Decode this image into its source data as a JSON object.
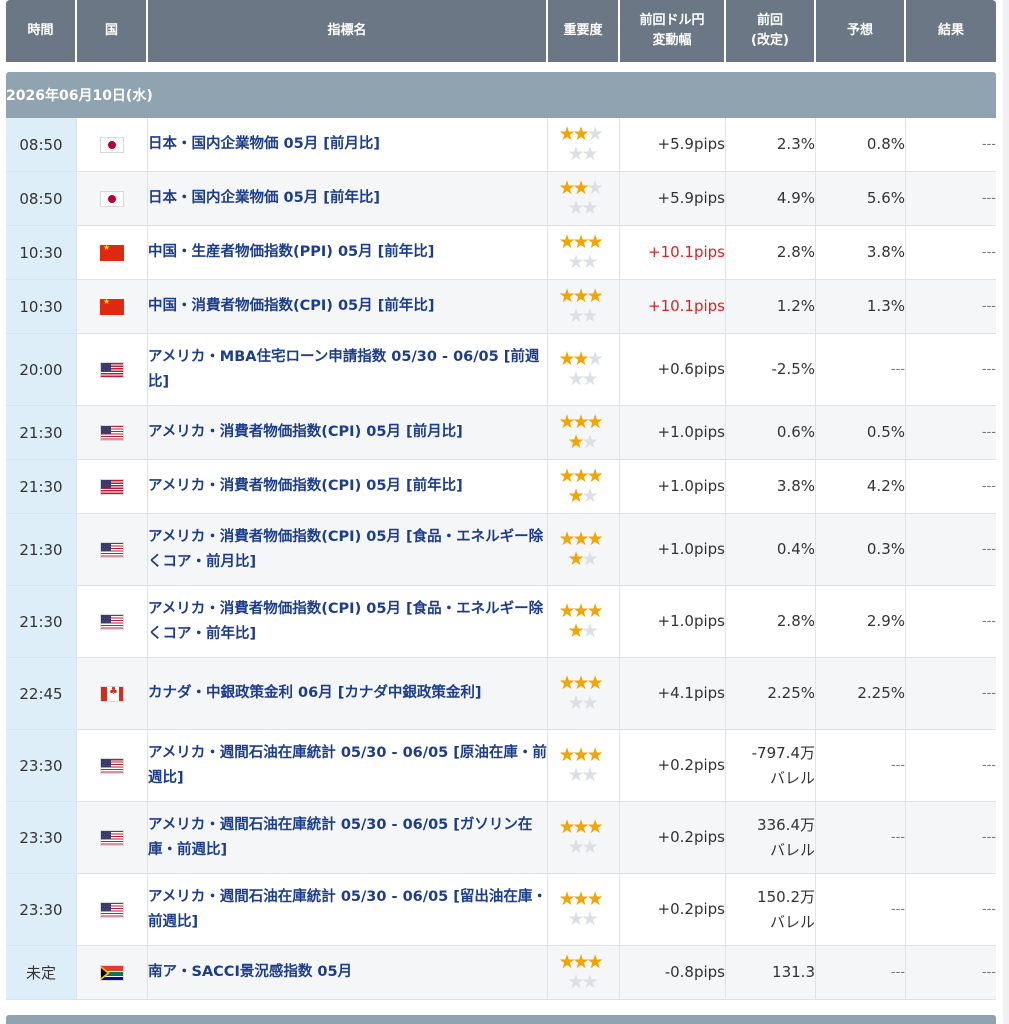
{
  "headers": {
    "time": "時間",
    "country": "国",
    "indicator": "指標名",
    "importance": "重要度",
    "change": "前回ドル円\n変動幅",
    "previous": "前回\n(改定)",
    "forecast": "予想",
    "result": "結果"
  },
  "date": "2026年06月10日(水)",
  "colors": {
    "header_bg": "#6b7784",
    "date_bg": "#8fa3b0",
    "time_bg": "#deeef9",
    "link": "#1c3d8c",
    "star_on": "#f2a400",
    "red": "#e02020"
  },
  "rows": [
    {
      "time": "08:50",
      "flag": "jp",
      "flag_icon": "japan-flag-icon",
      "name": "日本・国内企業物価 05月 [前月比]",
      "stars": 2,
      "change": "+5.9pips",
      "change_red": false,
      "previous": "2.3%",
      "forecast": "0.8%",
      "result": "---"
    },
    {
      "time": "08:50",
      "flag": "jp",
      "flag_icon": "japan-flag-icon",
      "name": "日本・国内企業物価 05月 [前年比]",
      "stars": 2,
      "change": "+5.9pips",
      "change_red": false,
      "previous": "4.9%",
      "forecast": "5.6%",
      "result": "---"
    },
    {
      "time": "10:30",
      "flag": "cn",
      "flag_icon": "china-flag-icon",
      "name": "中国・生産者物価指数(PPI) 05月 [前年比]",
      "stars": 3,
      "change": "+10.1pips",
      "change_red": true,
      "previous": "2.8%",
      "forecast": "3.8%",
      "result": "---"
    },
    {
      "time": "10:30",
      "flag": "cn",
      "flag_icon": "china-flag-icon",
      "name": "中国・消費者物価指数(CPI) 05月 [前年比]",
      "stars": 3,
      "change": "+10.1pips",
      "change_red": true,
      "previous": "1.2%",
      "forecast": "1.3%",
      "result": "---"
    },
    {
      "time": "20:00",
      "flag": "us",
      "flag_icon": "usa-flag-icon",
      "name": "アメリカ・MBA住宅ローン申請指数 05/30 - 06/05 [前週比]",
      "stars": 2,
      "change": "+0.6pips",
      "change_red": false,
      "previous": "-2.5%",
      "forecast": "---",
      "result": "---"
    },
    {
      "time": "21:30",
      "flag": "us",
      "flag_icon": "usa-flag-icon",
      "name": "アメリカ・消費者物価指数(CPI) 05月 [前月比]",
      "stars": 4,
      "change": "+1.0pips",
      "change_red": false,
      "previous": "0.6%",
      "forecast": "0.5%",
      "result": "---"
    },
    {
      "time": "21:30",
      "flag": "us",
      "flag_icon": "usa-flag-icon",
      "name": "アメリカ・消費者物価指数(CPI) 05月 [前年比]",
      "stars": 4,
      "change": "+1.0pips",
      "change_red": false,
      "previous": "3.8%",
      "forecast": "4.2%",
      "result": "---"
    },
    {
      "time": "21:30",
      "flag": "us",
      "flag_icon": "usa-flag-icon",
      "name": "アメリカ・消費者物価指数(CPI) 05月 [食品・エネルギー除くコア・前月比]",
      "stars": 4,
      "change": "+1.0pips",
      "change_red": false,
      "previous": "0.4%",
      "forecast": "0.3%",
      "result": "---"
    },
    {
      "time": "21:30",
      "flag": "us",
      "flag_icon": "usa-flag-icon",
      "name": "アメリカ・消費者物価指数(CPI) 05月 [食品・エネルギー除くコア・前年比]",
      "stars": 4,
      "change": "+1.0pips",
      "change_red": false,
      "previous": "2.8%",
      "forecast": "2.9%",
      "result": "---"
    },
    {
      "time": "22:45",
      "flag": "ca",
      "flag_icon": "canada-flag-icon",
      "name": "カナダ・中銀政策金利 06月 [カナダ中銀政策金利]",
      "stars": 3,
      "change": "+4.1pips",
      "change_red": false,
      "previous": "2.25%",
      "forecast": "2.25%",
      "result": "---"
    },
    {
      "time": "23:30",
      "flag": "us",
      "flag_icon": "usa-flag-icon",
      "name": "アメリカ・週間石油在庫統計 05/30 - 06/05 [原油在庫・前週比]",
      "stars": 3,
      "change": "+0.2pips",
      "change_red": false,
      "previous": "-797.4万\nバレル",
      "forecast": "---",
      "result": "---"
    },
    {
      "time": "23:30",
      "flag": "us",
      "flag_icon": "usa-flag-icon",
      "name": "アメリカ・週間石油在庫統計 05/30 - 06/05 [ガソリン在庫・前週比]",
      "stars": 3,
      "change": "+0.2pips",
      "change_red": false,
      "previous": "336.4万\nバレル",
      "forecast": "---",
      "result": "---"
    },
    {
      "time": "23:30",
      "flag": "us",
      "flag_icon": "usa-flag-icon",
      "name": "アメリカ・週間石油在庫統計 05/30 - 06/05 [留出油在庫・前週比]",
      "stars": 3,
      "change": "+0.2pips",
      "change_red": false,
      "previous": "150.2万\nバレル",
      "forecast": "---",
      "result": "---"
    },
    {
      "time": "未定",
      "flag": "za",
      "flag_icon": "south-africa-flag-icon",
      "name": "南ア・SACCI景況感指数 05月",
      "stars": 3,
      "change": "-0.8pips",
      "change_red": false,
      "previous": "131.3",
      "forecast": "---",
      "result": "---"
    }
  ]
}
